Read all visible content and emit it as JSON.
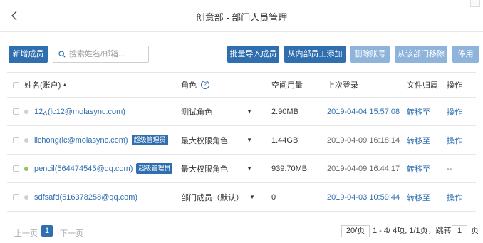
{
  "header": {
    "title": "创意部 - 部门人员管理"
  },
  "toolbar": {
    "add_member": "新增成员",
    "search_placeholder": "搜索姓名/邮箱...",
    "bulk_import": "批量导入成员",
    "add_internal": "从内部员工添加",
    "delete_account": "删除账号",
    "remove_from_dept": "从该部门移除",
    "disable": "停用"
  },
  "table": {
    "columns": {
      "name": "姓名(账户)",
      "role": "角色",
      "space": "空间用量",
      "last_login": "上次登录",
      "file_owner": "文件归属",
      "actions": "操作"
    },
    "rows": [
      {
        "name": "12¿",
        "email": "(lc12@molasync.com)",
        "badge": "",
        "online": false,
        "role": "测试角色",
        "space": "2.90MB",
        "last_login": "2019-04-04 15:57:08",
        "last_login_link": true,
        "transfer": "转移至",
        "action": "操作"
      },
      {
        "name": "lichong",
        "email": "(lc@molasync.com)",
        "badge": "超级管理员",
        "online": false,
        "role": "最大权限角色",
        "space": "1.44GB",
        "last_login": "2019-04-09 16:18:14",
        "last_login_link": false,
        "transfer": "转移至",
        "action": "操作"
      },
      {
        "name": "pencil",
        "email": "(564474545@qq.com)",
        "badge": "超级管理员",
        "online": true,
        "role": "最大权限角色",
        "space": "939.70MB",
        "last_login": "2019-04-09 16:44:17",
        "last_login_link": false,
        "transfer": "转移至",
        "action": "--"
      },
      {
        "name": "sdfsafd",
        "email": "(516378258@qq.com)",
        "badge": "",
        "online": false,
        "role": "部门成员（默认）",
        "space": "0",
        "last_login": "2019-04-03 10:59:44",
        "last_login_link": true,
        "transfer": "转移至",
        "action": "操作"
      }
    ]
  },
  "pagination": {
    "prev": "上一页",
    "current": "1",
    "next": "下一页",
    "page_size": "20/页",
    "summary": "1 - 4/ 4项, 1/1页，跳转到",
    "jump_value": "1",
    "page_unit": "页"
  },
  "colors": {
    "primary": "#2f6fb0",
    "disabled": "#8fb4dc",
    "online": "#8fc55a"
  },
  "icons": {
    "back": "chevron-left-icon",
    "search": "search-icon",
    "help": "question-circle-icon",
    "sort": "sort-up-icon",
    "dropdown": "caret-down-icon"
  }
}
